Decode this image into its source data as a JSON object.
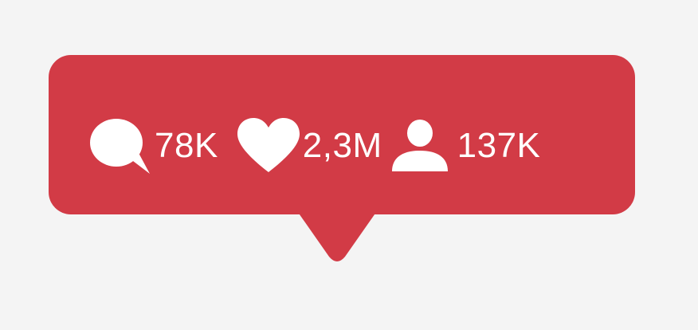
{
  "notification": {
    "background_color": "#d23b46",
    "foreground_color": "#ffffff",
    "stats": [
      {
        "icon": "comment-icon",
        "value": "78K"
      },
      {
        "icon": "heart-icon",
        "value": "2,3M"
      },
      {
        "icon": "follower-icon",
        "value": "137K"
      }
    ]
  }
}
